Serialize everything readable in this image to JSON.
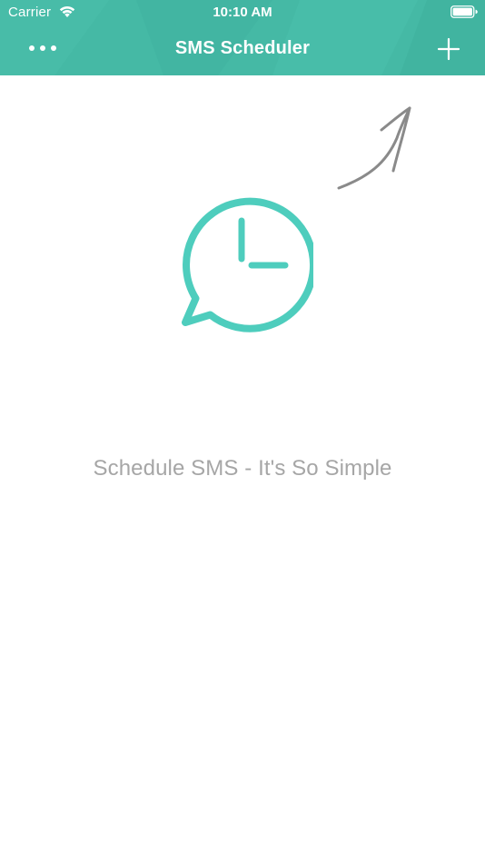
{
  "status_bar": {
    "carrier": "Carrier",
    "time": "10:10 AM",
    "wifi_icon": "wifi-icon",
    "battery_icon": "battery-icon"
  },
  "nav": {
    "title": "SMS Scheduler",
    "more_icon": "ellipsis-icon",
    "add_icon": "plus-icon"
  },
  "empty_state": {
    "logo_icon": "clock-speech-bubble-icon",
    "hint_icon": "arrow-hint-icon",
    "tagline": "Schedule SMS - It's So Simple"
  },
  "colors": {
    "accent": "#45b9a5",
    "logo": "#4ecdbd",
    "tagline": "#a6a6a6",
    "arrow": "#8a8a8a"
  }
}
